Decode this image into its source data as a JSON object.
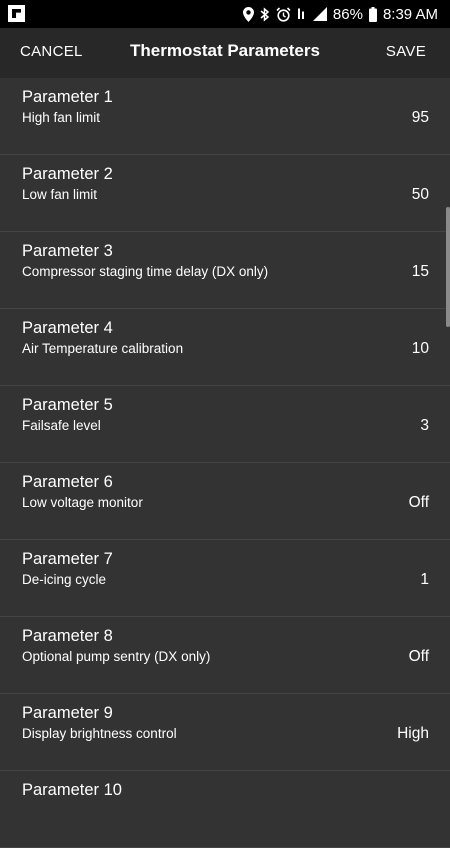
{
  "status_bar": {
    "battery": "86%",
    "time": "8:39 AM",
    "icons": [
      "flipboard-icon",
      "location-icon",
      "bluetooth-icon",
      "alarm-icon",
      "wifi-icon",
      "signal-icon",
      "battery-icon"
    ]
  },
  "app_bar": {
    "cancel_label": "CANCEL",
    "title": "Thermostat Parameters",
    "save_label": "SAVE"
  },
  "parameters": [
    {
      "title": "Parameter 1",
      "description": "High fan limit",
      "value": "95"
    },
    {
      "title": "Parameter 2",
      "description": "Low fan limit",
      "value": "50"
    },
    {
      "title": "Parameter 3",
      "description": "Compressor staging time delay (DX only)",
      "value": "15"
    },
    {
      "title": "Parameter 4",
      "description": "Air Temperature calibration",
      "value": "10"
    },
    {
      "title": "Parameter 5",
      "description": "Failsafe level",
      "value": "3"
    },
    {
      "title": "Parameter 6",
      "description": "Low voltage monitor",
      "value": "Off"
    },
    {
      "title": "Parameter 7",
      "description": "De-icing cycle",
      "value": "1"
    },
    {
      "title": "Parameter 8",
      "description": "Optional pump sentry (DX only)",
      "value": "Off"
    },
    {
      "title": "Parameter 9",
      "description": "Display brightness control",
      "value": "High"
    },
    {
      "title": "Parameter 10",
      "description": "",
      "value": ""
    }
  ]
}
